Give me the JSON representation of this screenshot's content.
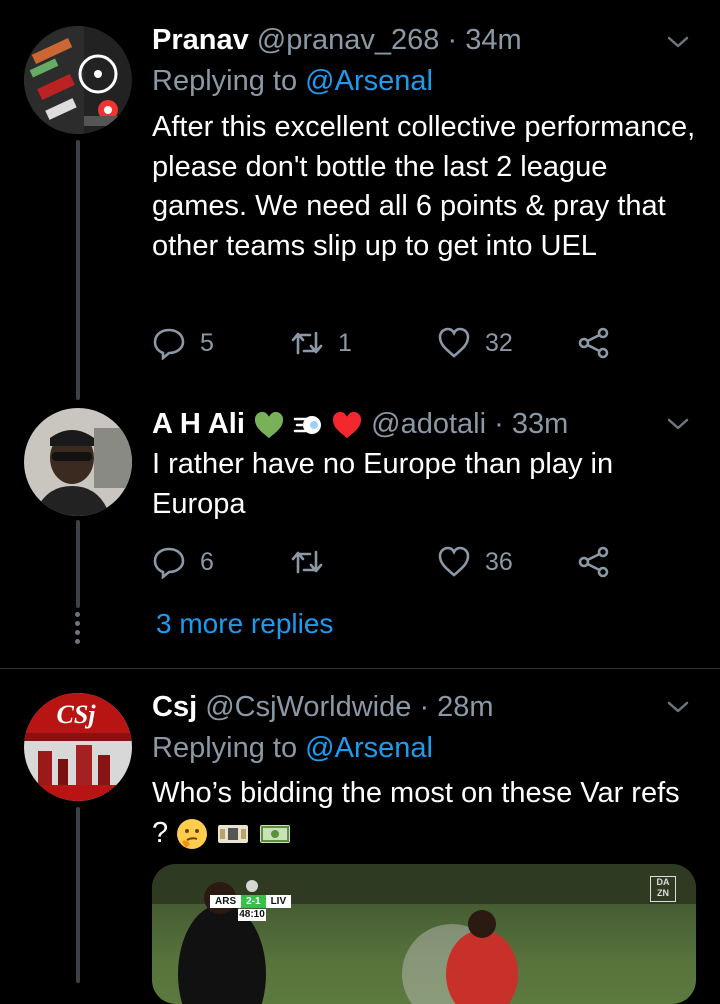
{
  "tweets": [
    {
      "name": "Pranav",
      "handle": "@pranav_268",
      "time": "· 34m",
      "replying_prefix": "Replying to",
      "replying_to": "@Arsenal",
      "text": "After this excellent collective performance, please don't bottle the last 2 league games. We need all 6 points & pray that other teams slip up to get into UEL",
      "replies": "5",
      "retweets": "1",
      "likes": "32"
    },
    {
      "name": "A H Ali",
      "handle": "@adotali",
      "time": "· 33m",
      "text": "I rather have no Europe than play in Europa",
      "replies": "6",
      "retweets": "",
      "likes": "36"
    },
    {
      "name": "Csj",
      "handle": "@CsjWorldwide",
      "time": "· 28m",
      "replying_prefix": "Replying to",
      "replying_to": "@Arsenal",
      "text": "Who’s bidding the most on these Var refs ?"
    }
  ],
  "more_replies": "3 more replies",
  "scoreboard": {
    "home": "ARS",
    "score": "2-1",
    "away": "LIV",
    "clock": "48:10",
    "watermark": "DA ZN"
  },
  "colors": {
    "accent": "#1d9bf0",
    "muted": "#8b98a5",
    "like_heart": "#f4262e",
    "green_heart": "#78b159"
  }
}
